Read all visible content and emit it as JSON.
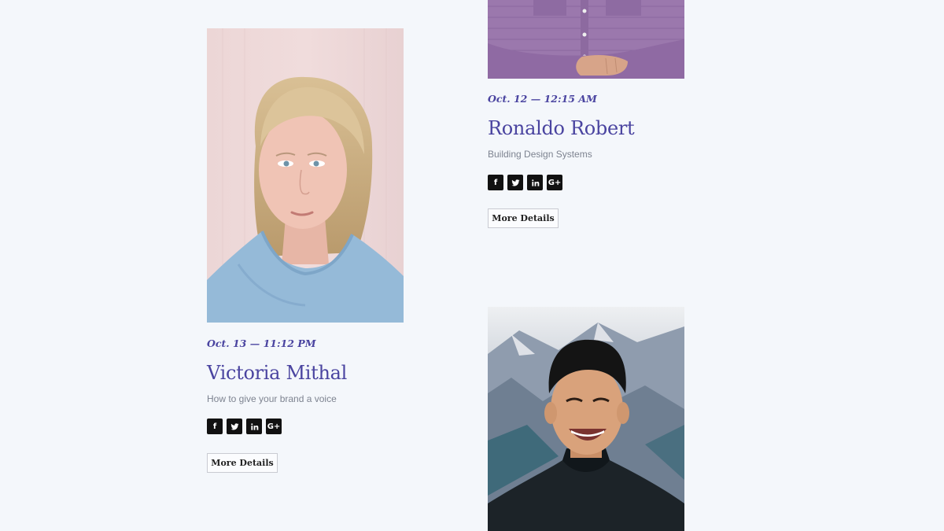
{
  "speakers": [
    {
      "meta": "Oct. 13 — 11:12 PM",
      "name": "Victoria Mithal",
      "topic": "How to give your brand a voice",
      "details_label": "More Details"
    },
    {
      "meta": "Oct. 12 — 12:15 AM",
      "name": "Ronaldo Robert",
      "topic": "Building Design Systems",
      "details_label": "More Details"
    }
  ],
  "social": {
    "facebook": "f",
    "googleplus": "G+"
  },
  "colors": {
    "page_bg": "#f4f7fb",
    "accent": "#4a44a0",
    "muted_text": "#7d8390",
    "icon_bg": "#111111"
  }
}
